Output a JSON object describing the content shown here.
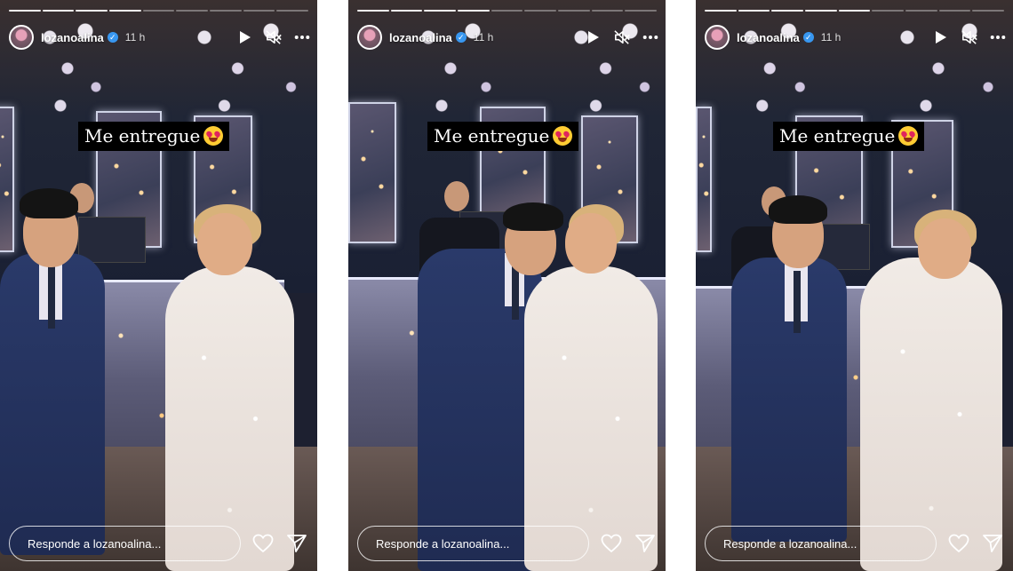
{
  "stories": [
    {
      "username": "lozanoalina",
      "time": "11 h",
      "caption": "Me entregue",
      "reply_placeholder": "Responde a lozanoalina...",
      "progress_done_segments": 4,
      "progress_total_segments": 9
    },
    {
      "username": "lozanoalina",
      "time": "11 h",
      "caption": "Me entregue",
      "reply_placeholder": "Responde a lozanoalina...",
      "progress_done_segments": 4,
      "progress_total_segments": 9
    },
    {
      "username": "lozanoalina",
      "time": "11 h",
      "caption": "Me entregue",
      "reply_placeholder": "Responde a lozanoalina...",
      "progress_done_segments": 5,
      "progress_total_segments": 9
    }
  ],
  "icons": {
    "play": "play-icon",
    "mute": "speaker-muted-icon",
    "more": "more-options-icon",
    "like": "heart-icon",
    "share": "send-icon",
    "verified": "verified-badge-icon"
  },
  "colors": {
    "verified_badge": "#3897f0",
    "caption_bg": "#000000",
    "caption_text": "#ffffff"
  }
}
